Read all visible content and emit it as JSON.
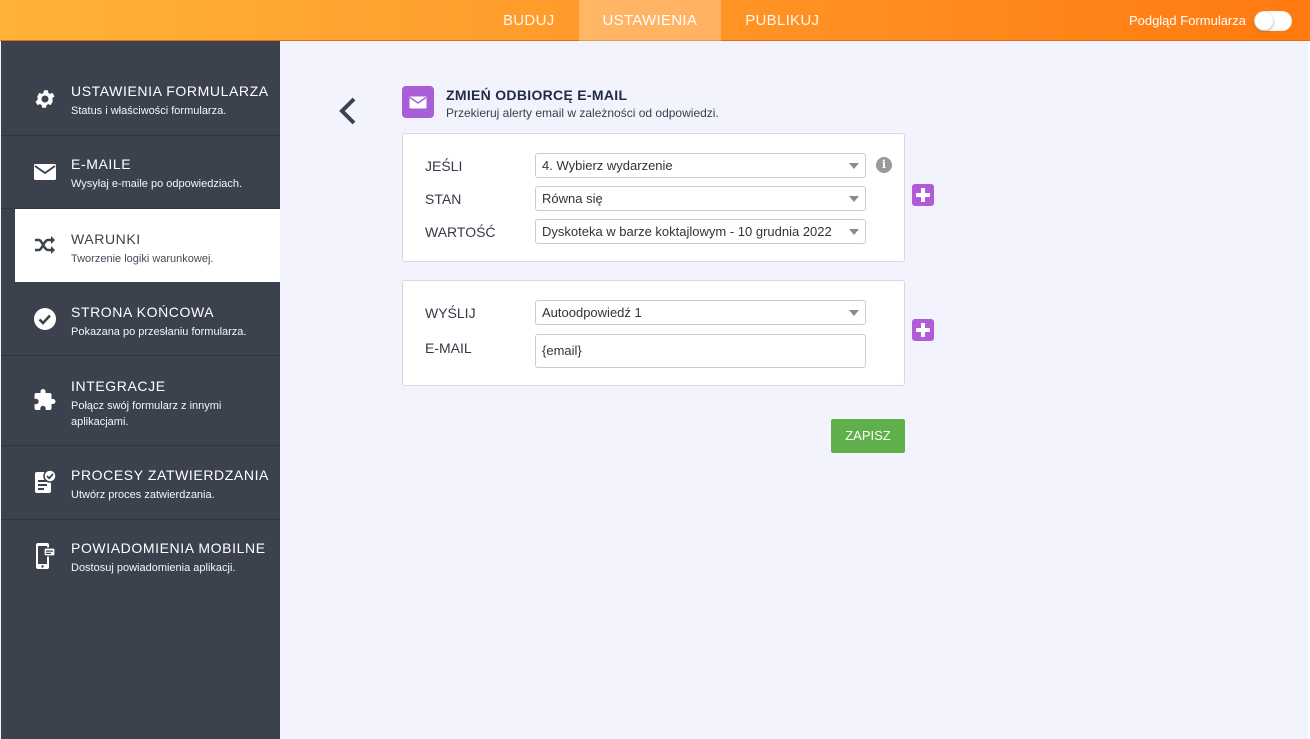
{
  "topbar": {
    "tabs": [
      {
        "label": "BUDUJ"
      },
      {
        "label": "USTAWIENIA"
      },
      {
        "label": "PUBLIKUJ"
      }
    ],
    "preview_label": "Podgląd Formularza"
  },
  "sidebar": {
    "items": [
      {
        "title": "USTAWIENIA FORMULARZA",
        "subtitle": "Status i właściwości formularza."
      },
      {
        "title": "E-MAILE",
        "subtitle": "Wysyłaj e-maile po odpowiedziach."
      },
      {
        "title": "WARUNKI",
        "subtitle": "Tworzenie logiki warunkowej."
      },
      {
        "title": "STRONA KOŃCOWA",
        "subtitle": "Pokazana po przesłaniu formularza."
      },
      {
        "title": "INTEGRACJE",
        "subtitle": "Połącz swój formularz z innymi aplikacjami."
      },
      {
        "title": "PROCESY ZATWIERDZANIA",
        "subtitle": "Utwórz proces zatwierdzania."
      },
      {
        "title": "POWIADOMIENIA MOBILNE",
        "subtitle": "Dostosuj powiadomienia aplikacji."
      }
    ]
  },
  "header": {
    "title": "ZMIEŃ ODBIORCĘ E-MAIL",
    "subtitle": "Przekieruj alerty email w zależności od odpowiedzi."
  },
  "condition": {
    "if_label": "JEŚLI",
    "if_value": "4. Wybierz wydarzenie",
    "state_label": "STAN",
    "state_value": "Równa się",
    "value_label": "WARTOŚĆ",
    "value_value": "Dyskoteka w barze koktajlowym - 10 grudnia 2022",
    "info_glyph": "i"
  },
  "action": {
    "send_label": "WYŚLIJ",
    "send_value": "Autoodpowiedź 1",
    "email_label": "E-MAIL",
    "email_value": "{email}"
  },
  "save_label": "ZAPISZ",
  "colors": {
    "accent_purple": "#b25bd8",
    "save_green": "#5fb04a",
    "sidebar_bg": "#3b414d",
    "topbar_orange": "#ff8a1e"
  }
}
